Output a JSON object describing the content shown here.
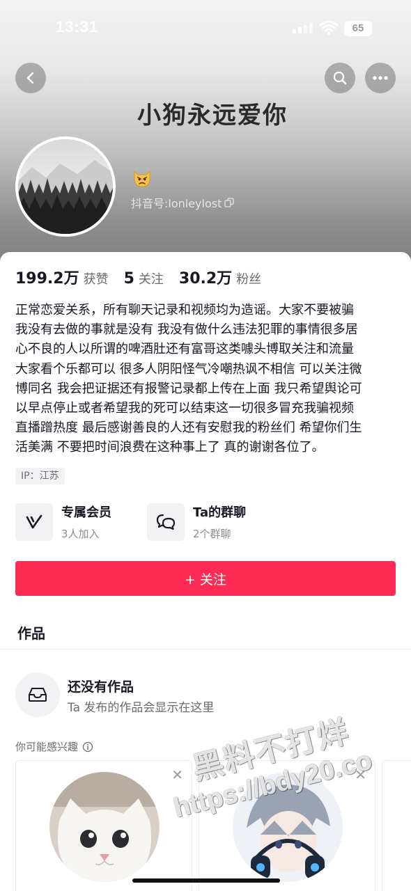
{
  "status_bar": {
    "time": "13:31",
    "battery": "65"
  },
  "header": {
    "banner_text": "小狗永远爱你",
    "douyin_id": "抖音号:lonleylost",
    "name_emoji": "😾"
  },
  "stats": [
    {
      "value": "199.2万",
      "label": "获赞"
    },
    {
      "value": "5",
      "label": "关注"
    },
    {
      "value": "30.2万",
      "label": "粉丝"
    }
  ],
  "bio": "正常恋爱关系，所有聊天记录和视频均为造谣。大家不要被骗\n我没有去做的事就是没有 我没有做什么违法犯罪的事情很多居\n心不良的人以所谓的啤酒肚还有富哥这类噱头博取关注和流量\n大家看个乐都可以 很多人阴阳怪气冷嘲热讽不相信 可以关注微\n博同名 我会把证据还有报警记录都上传在上面 我只希望舆论可\n以早点停止或者希望我的死可以结束这一切很多冒充我骗视频\n直播蹭热度 最后感谢善良的人还有安慰我的粉丝们 希望你们生\n活美满 不要把时间浪费在这种事上了 真的谢谢各位了。",
  "ip": "IP：江苏",
  "features": [
    {
      "title": "专属会员",
      "subtitle": "3人加入",
      "icon": "vip-v-icon"
    },
    {
      "title": "Ta的群聊",
      "subtitle": "2个群聊",
      "icon": "group-chat-icon"
    }
  ],
  "follow_button": "+ 关注",
  "tabs": {
    "works": "作品"
  },
  "empty_state": {
    "title": "还没有作品",
    "subtitle": "Ta 发布的作品会显示在这里"
  },
  "interest_label": "你可能感兴趣",
  "watermark": {
    "line1": "黑料不打烊",
    "line2": "https://bdy20.co"
  },
  "colors": {
    "accent": "#fe2c55",
    "text": "#161823",
    "muted": "#6b6b70"
  }
}
